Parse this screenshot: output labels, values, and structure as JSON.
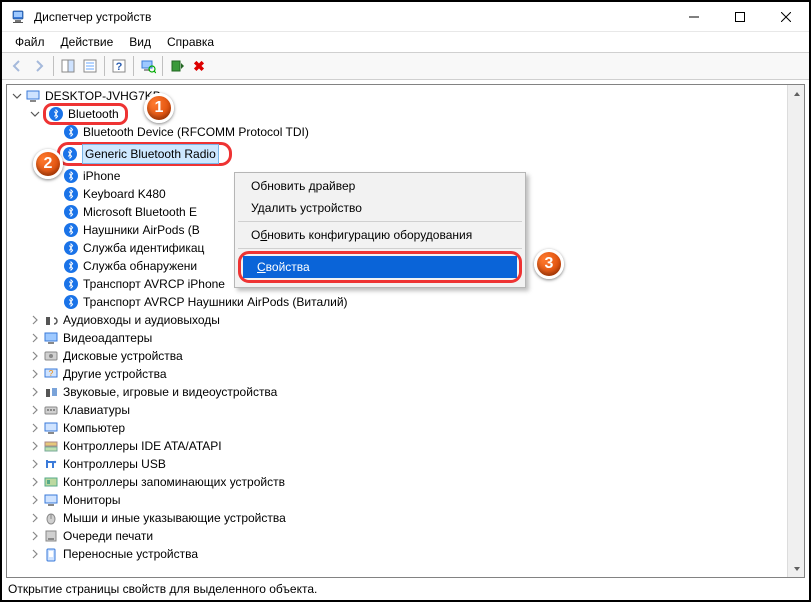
{
  "window": {
    "title": "Диспетчер устройств"
  },
  "menu": {
    "file": "Файл",
    "action": "Действие",
    "view": "Вид",
    "help": "Справка"
  },
  "tree": {
    "root": "DESKTOP-JVHG7KB",
    "bluetooth": "Bluetooth",
    "bt_children": [
      "Bluetooth Device (RFCOMM Protocol TDI)",
      "Generic Bluetooth Radio",
      "iPhone",
      "Keyboard K480",
      "Microsoft Bluetooth E",
      "Наушники AirPods (В",
      "Служба идентификац",
      "Служба обнаружени",
      "Транспорт AVRCP iPhone",
      "Транспорт AVRCP Наушники AirPods (Виталий)"
    ],
    "categories": [
      "Аудиовходы и аудиовыходы",
      "Видеоадаптеры",
      "Дисковые устройства",
      "Другие устройства",
      "Звуковые, игровые и видеоустройства",
      "Клавиатуры",
      "Компьютер",
      "Контроллеры IDE ATA/ATAPI",
      "Контроллеры USB",
      "Контроллеры запоминающих устройств",
      "Мониторы",
      "Мыши и иные указывающие устройства",
      "Очереди печати",
      "Переносные устройства"
    ]
  },
  "context_menu": {
    "update": "Обновить драйвер",
    "remove": "Удалить устройство",
    "rescan_pre": "О",
    "rescan_u": "б",
    "rescan_post": "новить конфигурацию оборудования",
    "props_u": "С",
    "props_post": "войства"
  },
  "badges": {
    "n1": "1",
    "n2": "2",
    "n3": "3"
  },
  "status": "Открытие страницы свойств для выделенного объекта."
}
